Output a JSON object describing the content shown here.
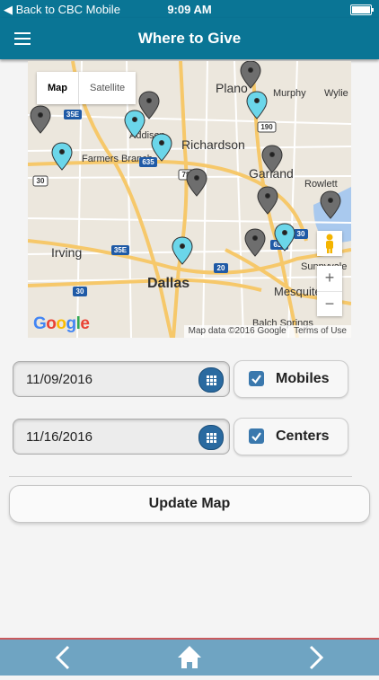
{
  "status_bar": {
    "back_label": "◀ Back to CBC Mobile",
    "time": "9:09 AM"
  },
  "header": {
    "title": "Where to Give",
    "menu_icon": "hamburger-menu-icon"
  },
  "map": {
    "toggle": {
      "map_label": "Map",
      "satellite_label": "Satellite",
      "selected": "Map"
    },
    "city_labels": [
      "Plano",
      "Murphy",
      "Wylie",
      "Addison",
      "Richardson",
      "Farmers Branch",
      "Garland",
      "Rowlett",
      "Irving",
      "Dallas",
      "Sunnyvale",
      "Mesquite",
      "Balch Springs"
    ],
    "highway_labels": [
      "35E",
      "190",
      "635",
      "75",
      "30",
      "35E",
      "30",
      "20",
      "635",
      "30"
    ],
    "attribution": "Map data ©2016 Google",
    "terms": "Terms of Use",
    "google_logo": "Google",
    "zoom_in": "+",
    "zoom_out": "−",
    "pin_colors": {
      "mobile": "#6bd6ea",
      "center": "#6e6e6e"
    }
  },
  "filters": [
    {
      "date": "11/09/2016",
      "calendar_icon": "calendar-icon",
      "checkbox_label": "Mobiles",
      "checked": true
    },
    {
      "date": "11/16/2016",
      "calendar_icon": "calendar-icon",
      "checkbox_label": "Centers",
      "checked": true
    }
  ],
  "update_button": "Update Map",
  "footer": {
    "back_icon": "chevron-left-icon",
    "home_icon": "home-icon",
    "forward_icon": "chevron-right-icon"
  },
  "colors": {
    "header": "#0a7595",
    "footer": "#6fa4c2",
    "checkbox": "#3a78ad"
  }
}
